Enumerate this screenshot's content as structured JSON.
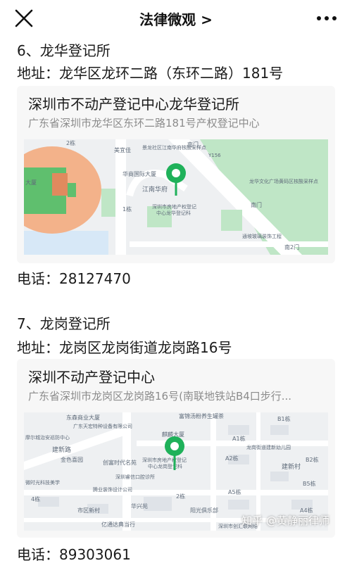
{
  "nav": {
    "title": "法律微观 >",
    "close_icon": "close-icon",
    "more_icon": "more-dots-icon"
  },
  "section6": {
    "heading": "6、龙华登记所",
    "address": "地址：龙华区龙环二路（东环二路）181号",
    "card": {
      "title": "深圳市不动产登记中心龙华登记所",
      "address": "广东省深圳市龙华区东环二路181号产权登记中心"
    },
    "map": {
      "poi_label": "深圳市房地产权登记中心龙华登记科",
      "labels": [
        "2栋",
        "美宜佳",
        "景龙社区江南华府核酸采样点",
        "南门",
        "Y156",
        "华商国际大厦",
        "江南华府",
        "龙华文化广场黄码区核酸采样点",
        "1栋",
        "南门",
        "深圳市房地产权登记",
        "中心龙华登记科",
        "通坡玻璃装饰工程",
        "南2门",
        "大厦"
      ]
    },
    "phone": "电话：28127470"
  },
  "section7": {
    "heading": "7、龙岗登记所",
    "address": "地址：龙岗区龙岗街道龙岗路16号",
    "card": {
      "title": "深圳不动产登记中心",
      "address": "广东省深圳市龙岗区龙岗路16号(南联地铁站B4口步行..."
    },
    "map": {
      "labels": [
        "东森商业大厦",
        "富锦汤粉养生罐茶",
        "B1栋",
        "广东天宏特种设备有限公司",
        "摩尔城治安巡防中心",
        "麒麟大厦",
        "A1栋",
        "龙岗街道建新幼儿园",
        "建新路",
        "金色喜园",
        "创富时代名苑",
        "深圳市房地产权登记",
        "中心龙岗登记科",
        "A2栋",
        "建新村",
        "B2栋",
        "微时光科技美学",
        "深圳睿信口腔诊所",
        "B5栋",
        "腾业装饰设计公司",
        "A5栋",
        "市区新村",
        "华兴苑",
        "阳光俱乐部",
        "亿通达典当行",
        "深圳市创汇联网络",
        "4栋",
        "2栋",
        "A4栋"
      ]
    },
    "phone": "电话：89303061"
  },
  "watermark": "知乎 @黄静丽律师",
  "colors": {
    "marker_green": "#1fb15a",
    "map_green": "#bfe6c6",
    "map_road": "#ffffff",
    "map_bg": "#eef0f2",
    "map_orange": "#f0a57a"
  }
}
